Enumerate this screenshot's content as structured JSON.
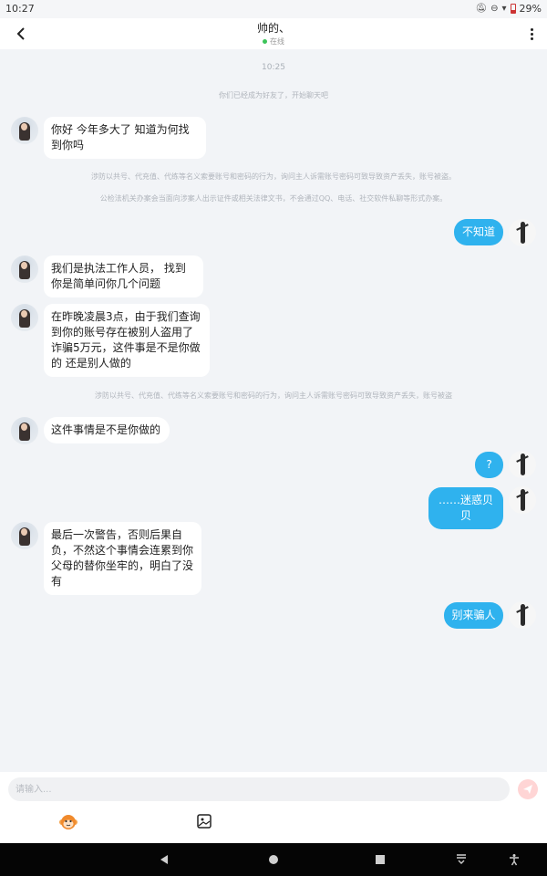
{
  "status": {
    "time": "10:27",
    "battery": "29%"
  },
  "header": {
    "name": "帅的、",
    "status": "在线"
  },
  "messages": {
    "timestamp": "10:25",
    "friend_notice": "你们已经成为好友了，开始聊天吧",
    "m1": "你好 今年多大了 知道为何找到你吗",
    "warn1": "涉防以共号、代充值、代练等名义索要账号和密码的行为，询问主人诉需账号密码可致导致资产丢失，账号被盗。",
    "warn2": "公检法机关办案会当面向涉案人出示证件或相关法律文书，不会通过QQ、电话、社交软件私聊等形式办案。",
    "r1": "不知道",
    "m2": "我们是执法工作人员， 找到你是简单问你几个问题",
    "m3": "在昨晚凌晨3点，由于我们查询到你的账号存在被别人盗用了诈骗5万元，这件事是不是你做的 还是别人做的",
    "warn3": "涉防以共号、代充值、代练等名义索要账号和密码的行为，询问主人诉需账号密码可致导致资产丢失，账号被盗",
    "m4": "这件事情是不是你做的",
    "r2": "?",
    "r3": "……迷惑贝贝",
    "m5": "最后一次警告，否则后果自负，不然这个事情会连累到你父母的替你坐牢的，明白了没有",
    "r4": "别来骗人"
  },
  "input": {
    "placeholder": "请输入..."
  },
  "icons": {
    "back": "chevron-left-icon",
    "more": "more-vertical-icon",
    "send": "send-icon",
    "emoji": "monkey-emoji-icon",
    "image": "image-icon"
  },
  "colors": {
    "accent": "#2fb2ee",
    "background": "#f2f4f7",
    "online": "#3cc45a"
  }
}
